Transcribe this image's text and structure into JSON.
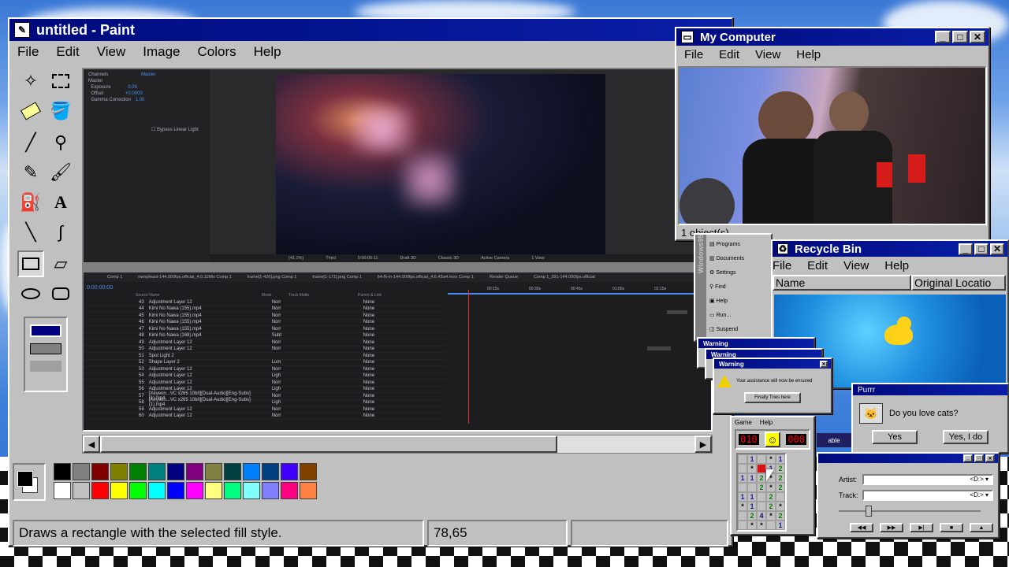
{
  "paint": {
    "title": "untitled - Paint",
    "menu": [
      "File",
      "Edit",
      "View",
      "Image",
      "Colors",
      "Help"
    ],
    "status_text": "Draws a rectangle with the selected fill style.",
    "coords": "78,65",
    "tools": [
      "free-select-icon",
      "select-icon",
      "eraser-icon",
      "fill-icon",
      "eyedropper-icon",
      "magnifier-icon",
      "pencil-icon",
      "brush-icon",
      "airbrush-icon",
      "text-icon",
      "line-icon",
      "curve-icon",
      "rectangle-icon",
      "polygon-icon",
      "ellipse-icon",
      "rounded-rect-icon"
    ],
    "palette_top": [
      "#000000",
      "#808080",
      "#800000",
      "#808000",
      "#008000",
      "#008080",
      "#000080",
      "#800080",
      "#808040",
      "#004040",
      "#0080ff",
      "#004080",
      "#4000ff",
      "#804000"
    ],
    "palette_bottom": [
      "#ffffff",
      "#c0c0c0",
      "#ff0000",
      "#ffff00",
      "#00ff00",
      "#00ffff",
      "#0000ff",
      "#ff00ff",
      "#ffff80",
      "#00ff80",
      "#80ffff",
      "#8080ff",
      "#ff0080",
      "#ff8040"
    ]
  },
  "after_effects": {
    "effect_props": [
      "Channels",
      "Master",
      "Exposure",
      "Offset",
      "Gamma Correction",
      "Bypass Linear Light"
    ],
    "effect_values": [
      "Master",
      "0.00",
      "+0.0000",
      "1.00"
    ],
    "tabs": [
      "Comp 1",
      "nwnpfeast-144.000fps.official_4.0.11Mix Comp 1",
      "frame[1-426].png Comp 1",
      "frame[1-171].png Comp 1",
      "lt4-N-m-144.000fps.official_4.6.4Sa4.mov Comp 1",
      "Render Queue",
      "Comp 1_291-144.000fps.official"
    ],
    "timecode": "0:00:00:00",
    "columns": [
      "Source Name",
      "Mode",
      "Track Matte",
      "Parent & Link"
    ],
    "layers": [
      [
        "43",
        "Adjustment Layer 12",
        "Norr",
        "None"
      ],
      [
        "44",
        "Kimi No Nawa (155).mp4",
        "Norr",
        "None"
      ],
      [
        "45",
        "Kimi No Nawa (155).mp4",
        "Norr",
        "None"
      ],
      [
        "46",
        "Kimi No Nawa (155).mp4",
        "Norr",
        "None"
      ],
      [
        "47",
        "Kimi No Nawa (155).mp4",
        "Norr",
        "None"
      ],
      [
        "48",
        "Kimi No Nawa (168).mp4",
        "Subt",
        "None"
      ],
      [
        "49",
        "Adjustment Layer 12",
        "Norr",
        "None"
      ],
      [
        "50",
        "Adjustment Layer 12",
        "Norr",
        "None"
      ],
      [
        "51",
        "Spot Light 2",
        "",
        "None"
      ],
      [
        "52",
        "Shape Layer 2",
        "Lum",
        "None"
      ],
      [
        "53",
        "Adjustment Layer 12",
        "Norr",
        "None"
      ],
      [
        "54",
        "Adjustment Layer 12",
        "Ligh",
        "None"
      ],
      [
        "55",
        "Adjustment Layer 12",
        "Norr",
        "None"
      ],
      [
        "56",
        "Adjustment Layer 12",
        "Ligh",
        "None"
      ],
      [
        "57",
        "[Xeyeon...VC x265 10bit][Dual-Audio][Eng-Subs] (1).mp4",
        "Norr",
        "None"
      ],
      [
        "58",
        "[Xeyeon...VC x265 10bit][Dual-Audio][Eng-Subs] (1).mp4",
        "Ligh",
        "None"
      ],
      [
        "59",
        "Adjustment Layer 12",
        "Norr",
        "None"
      ],
      [
        "60",
        "Adjustment Layer 12",
        "Norr",
        "None"
      ]
    ],
    "ruler": [
      "00:15s",
      "00:30s",
      "00:45s",
      "01:00s",
      "01:15s"
    ],
    "viewer_bar": [
      "(41.1%)",
      "Third",
      "0:00:05:11",
      "Draft 3D",
      "Classic 3D",
      "Active Camera",
      "1 View"
    ]
  },
  "my_computer": {
    "title": "My Computer",
    "menu": [
      "File",
      "Edit",
      "View",
      "Help"
    ],
    "status": "1 object(s)"
  },
  "start_menu": {
    "items": [
      "Programs",
      "Documents",
      "Settings",
      "Find",
      "Help",
      "Run...",
      "Suspend"
    ],
    "banner": "Windows95"
  },
  "recycle_bin": {
    "title": "Recycle Bin",
    "menu": [
      "File",
      "Edit",
      "View",
      "Help"
    ],
    "columns": [
      "Name",
      "Original Locatio"
    ]
  },
  "warnings": {
    "title": "Warning",
    "message": "Your assistance will now be ensured",
    "button": "Finally Tries here"
  },
  "purrr": {
    "title": "Purrr",
    "question": "Do you love cats?",
    "yes": "Yes",
    "yes_i_do": "Yes, I do"
  },
  "minesweeper": {
    "menu": [
      "Game",
      "Help"
    ],
    "counter_left": "010",
    "counter_right": "008",
    "grid": [
      [
        "",
        "1",
        "",
        "*",
        "1"
      ],
      [
        "",
        "*",
        "",
        "1",
        "2"
      ],
      [
        "1",
        "1",
        "2",
        "*",
        "2"
      ],
      [
        "",
        "",
        "2",
        "*",
        "2"
      ],
      [
        "1",
        "1",
        "",
        "2",
        ""
      ],
      [
        "*",
        "1",
        "",
        "2",
        "*"
      ],
      [
        "",
        "2",
        "4",
        "*",
        "2"
      ],
      [
        "",
        "*",
        "*",
        "",
        "1"
      ]
    ]
  },
  "cd_player": {
    "artist_label": "Artist:",
    "track_label": "Track:",
    "artist_value": "<D:>",
    "track_value": "<D:>",
    "tab_label": "able"
  }
}
